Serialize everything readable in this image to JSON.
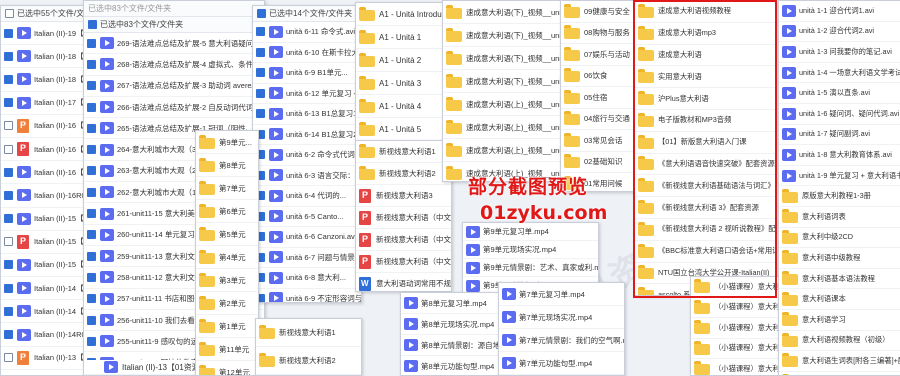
{
  "panel1": {
    "header": "已选中55个文件/文件夹",
    "rows": [
      "Italian (II)-19【01",
      "Italian (II)-18【01",
      "Italian (II)-18【01",
      "Italian (II)-17【01",
      "Italian (II)-16【01",
      "Italian (II)-16【01",
      "Italian (II)-16【01",
      "Italian (II)-16R01",
      "Italian (II)-15【01",
      "Italian (II)-15【01",
      "Italian (II)-15【01",
      "Italian (II)-14【01",
      "Italian (II)-14【01",
      "Italian (II)-14R01",
      "Italian (II)-13【01",
      "Italian (II)-13【01"
    ],
    "icons": [
      "video",
      "video",
      "video",
      "video",
      "ppt",
      "pdf",
      "video",
      "video",
      "video",
      "pdf",
      "video",
      "video",
      "video",
      "video",
      "ppt",
      "video"
    ],
    "checked": [
      true,
      true,
      true,
      true,
      false,
      false,
      true,
      true,
      true,
      false,
      true,
      true,
      true,
      true,
      false,
      true
    ]
  },
  "panel2": {
    "header": "已选中83个文件/文件夹",
    "top_line": "已选中83个文件/文件夹",
    "rows": [
      "269-语法难点总结及扩展-5 意大利语疑问...",
      "268-语法难点总结及扩展-4 虚拟式、条件复合式",
      "267-语法难点总结及扩展-3 助动词 avere/essere的选用",
      "266-语法难点总结及扩展-2 自反动词代词式动词、无人称",
      "265-语法难点总结及扩展-1 冠词（阴性、不定冠词）",
      "264-意大利城市大观（3）.avi",
      "263-意大利城市大观（2）.avi",
      "262-意大利城市大观（1）.avi",
      "261-unit11-15 意大利美食...",
      "260-unit11-14 单元复习.avi",
      "259-unit11-13 意大利文学...",
      "258-unit11-12 意大利文学...",
      "257-unit11-11 书店和图书馆...",
      "256-unit11-10 我们去看...",
      "255-unit11-9 感叹句的运用.avi",
      "254-unit11-8 阿拉伯数字的..."
    ],
    "footer": "Italian (II)-13【01资源网：01zyku.com】.mp4"
  },
  "panel3": {
    "header": "已选中14个文件/文件夹",
    "rows": [
      "unità 6-11 命令式.avi",
      "unità 6-10 在斯卡拉大剧院",
      "unità 6-9 B1单元...",
      "unità 6-12 单元复习 + 意...",
      "unità 6-13 B1总复习1.avi",
      "unità 6-14 B1总复习2.avi",
      "unità 6-2 命令式代词.avi",
      "unità 6-3 语言交际：...",
      "unità 6-4 代词的...",
      "unità 6-5 Canto...",
      "unità 6-6 Canzoni.avi",
      "unità 6-7 问题与情景.avi",
      "unità 6-8 意大利...",
      "unità 6-9 不定形容词与不定代词.avi"
    ]
  },
  "panel4": {
    "rows": [
      "A1 - Unità Introduttiva",
      "A1 - Unità 1",
      "A1 - Unità 2",
      "A1 - Unità 3",
      "A1 - Unità 4",
      "A1 - Unità 5"
    ]
  },
  "panel5": {
    "rows": [
      "新视线意大利语1",
      "新视线意大利语2",
      "新视线意大利语3",
      "新视线意大利语（中文版）.pdf",
      "新视线意大利语（中文版）.pdf",
      "新视线意大利语（中文版）练习...",
      "意大利语动词常用不规则变位表.doc"
    ],
    "icons": [
      "folder",
      "folder",
      "pdf",
      "pdf",
      "pdf",
      "pdf",
      "doc"
    ]
  },
  "panel6": {
    "rows": [
      "速成意大利语(下)_视频__unità34-35",
      "速成意大利语(下)_视频__unità29-33",
      "速成意大利语(下)_视频__unità24-28",
      "速成意大利语(下)_视频__unità19-23",
      "速成意大利语(上)_视频__unità15-18",
      "速成意大利语(上)_视频__unità10-14",
      "速成意大利语(上)_视频__unità05-09",
      "速成意大利语(上)_视频__unità00-04"
    ]
  },
  "panel7": {
    "rows": [
      "09健康与安全",
      "08购物与服务",
      "07娱乐与活动",
      "06饮食",
      "05住宿",
      "04旅行与交通",
      "03常见会话",
      "02基础知识",
      "01常用问候"
    ]
  },
  "panel8": {
    "rows": [
      "第9单元...",
      "第8单元",
      "第7单元",
      "第6单元",
      "第5单元",
      "第4单元",
      "第3单元",
      "第2单元",
      "第1单元",
      "第11单元",
      "第12单元"
    ]
  },
  "panel9": {
    "rows": [
      "第9单元复习单.mp4",
      "第9单元现场实况.mp4",
      "第9单元情景剧：艺术、真家或利.mp4",
      "第9单元功能句型.mp4"
    ]
  },
  "panel10": {
    "rows": [
      "第8单元复习单.mp4",
      "第8单元现场实况.mp4",
      "第8单元情景剧：源自地方与艺术...",
      "第8单元功能句型.mp4"
    ]
  },
  "panel11": {
    "rows": [
      "第7单元复习单.mp4",
      "第7单元现场实况.mp4",
      "第7单元情景剧：我们的空气啊.mp4",
      "第7单元功能句型.mp4"
    ]
  },
  "panel12": {
    "rows": [
      "速成意大利语视频教程",
      "速成意大利语mp3",
      "速成意大利语",
      "实用意大利语",
      "沪Plus意大利语",
      "电子版教材和MP3音频",
      "【01】新版意大利语入门课",
      "《意大利语语音快速突破》配套资源",
      "《新视线意大利语基础语法与词汇》",
      "《新视线意大利语 3》配套资源",
      "《新视线意大利语 2 视听说教程》配套资源",
      "《BBC标准意大利语口语会话+常用词词表》配套",
      "NTU国立台湾大学公开课-Italian(II)",
      "ascolto 系列"
    ]
  },
  "panel13": {
    "rows": [
      "（小猫课程）意大利语A1",
      "（小猫课程）意大利语B2",
      "（小猫课程）意大利语B1",
      "（小猫课程）意大利语A2",
      "（小猫课程）意大利语..."
    ]
  },
  "panel14": {
    "rows": [
      "unità 1-1 迎合代词1.avi",
      "unità 1-2 迎合代词2.avi",
      "unità 1-3 问我要你的笔记.avi",
      "unità 1-4 一场意大利语文学考试.avi",
      "unità 1-5 演以直条.avi",
      "unità 1-6 疑问词、疑问代词.avi",
      "unità 1-7 疑问副词.avi",
      "unità 1-8 意大利教育体系.avi",
      "unità 1-9 单元复习 + 意大利语书1.avi",
      "原版意大利教程1-3册",
      "意大利语词表",
      "意大利中级2CD",
      "意大利语中级教程",
      "意大利语基本语法教程",
      "意大利语课本",
      "意大利语学习",
      "意大利语视频教程（初级）",
      "意大利语生词表[附各三编著]+配套",
      "（小猫课程）意大利语B1"
    ],
    "icons": [
      "video",
      "video",
      "video",
      "video",
      "video",
      "video",
      "video",
      "video",
      "video",
      "folder",
      "folder",
      "folder",
      "folder",
      "folder",
      "folder",
      "folder",
      "folder",
      "folder",
      "folder"
    ]
  },
  "overlay": {
    "title": "部分截图预览",
    "site": "01zyku.com"
  },
  "watermark": "01资源网",
  "colors": {
    "accent_red": "#e01818",
    "folder": "#f7c948",
    "video": "#5b6cf0",
    "pdf": "#e64545",
    "checkbox": "#2f6fd6"
  }
}
